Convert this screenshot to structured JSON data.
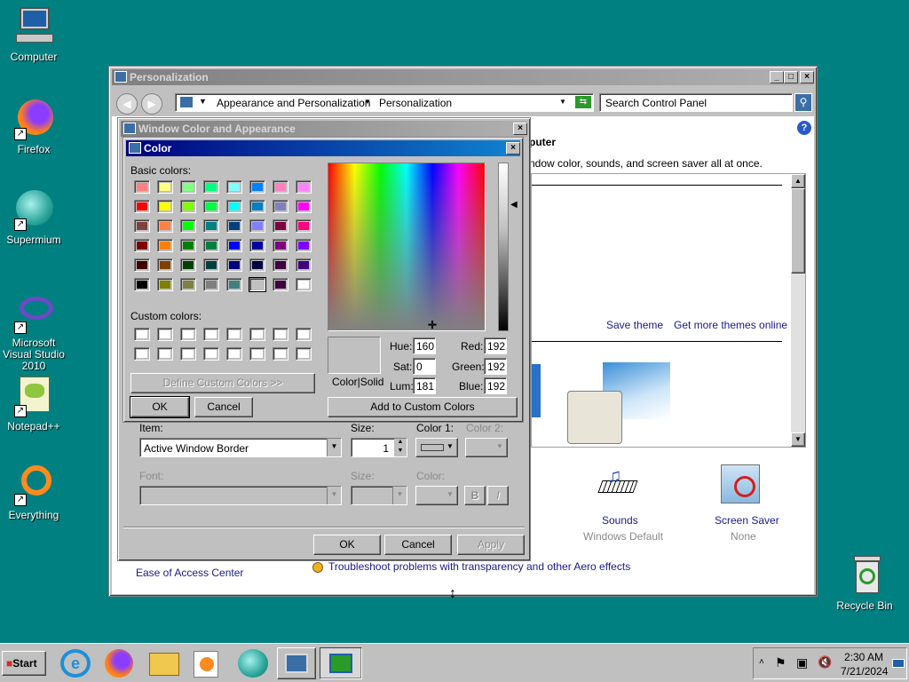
{
  "desktop": {
    "icons": [
      {
        "name": "computer-desktop-icon",
        "label": "Computer"
      },
      {
        "name": "firefox-desktop-icon",
        "label": "Firefox"
      },
      {
        "name": "supermium-desktop-icon",
        "label": "Supermium"
      },
      {
        "name": "visual-studio-desktop-icon",
        "label": "Microsoft Visual Studio 2010"
      },
      {
        "name": "notepadpp-desktop-icon",
        "label": "Notepad++"
      },
      {
        "name": "everything-desktop-icon",
        "label": "Everything"
      },
      {
        "name": "recycle-bin-desktop-icon",
        "label": "Recycle Bin"
      }
    ]
  },
  "personalization": {
    "title": "Personalization",
    "breadcrumb": [
      "Appearance and Personalization",
      "Personalization"
    ],
    "search_placeholder": "Search Control Panel",
    "heading_partial": "puter",
    "desc_partial": "ndow color, sounds, and screen saver all at once.",
    "save_theme": "Save theme",
    "get_more_themes": "Get more themes online",
    "sounds_label": "Sounds",
    "sounds_value": "Windows Default",
    "screensaver_label": "Screen Saver",
    "screensaver_value": "None",
    "ease_of_access": "Ease of Access Center",
    "troubleshoot": "Troubleshoot problems with transparency and other Aero effects"
  },
  "wca": {
    "title": "Window Color and Appearance",
    "item_label": "Item:",
    "item_value": "Active Window Border",
    "size_label": "Size:",
    "size_value": "1",
    "color1_label": "Color 1:",
    "color2_label": "Color 2:",
    "font_label": "Font:",
    "font_size_label": "Size:",
    "font_color_label": "Color:",
    "bold": "B",
    "italic": "I",
    "ok": "OK",
    "cancel": "Cancel",
    "apply": "Apply"
  },
  "color_dialog": {
    "title": "Color",
    "basic_colors_label": "Basic colors:",
    "custom_colors_label": "Custom colors:",
    "define_custom": "Define Custom Colors >>",
    "ok": "OK",
    "cancel": "Cancel",
    "add_custom": "Add to Custom Colors",
    "color_solid": "Color|Solid",
    "hue_label": "Hue:",
    "hue": "160",
    "sat_label": "Sat:",
    "sat": "0",
    "lum_label": "Lum:",
    "lum": "181",
    "red_label": "Red:",
    "red": "192",
    "green_label": "Green:",
    "green": "192",
    "blue_label": "Blue:",
    "blue": "192",
    "selected_color": "#c0c0c0",
    "basic_colors": [
      "#ff8080",
      "#ffff80",
      "#80ff80",
      "#00ff80",
      "#80ffff",
      "#0080ff",
      "#ff80c0",
      "#ff80ff",
      "#ff0000",
      "#ffff00",
      "#80ff00",
      "#00ff40",
      "#00ffff",
      "#0080c0",
      "#8080c0",
      "#ff00ff",
      "#804040",
      "#ff8040",
      "#00ff00",
      "#008080",
      "#004080",
      "#8080ff",
      "#800040",
      "#ff0080",
      "#800000",
      "#ff8000",
      "#008000",
      "#008040",
      "#0000ff",
      "#0000a0",
      "#800080",
      "#8000ff",
      "#400000",
      "#804000",
      "#004000",
      "#004040",
      "#000080",
      "#000040",
      "#400040",
      "#400080",
      "#000000",
      "#808000",
      "#808040",
      "#808080",
      "#408080",
      "#c0c0c0",
      "#400040",
      "#ffffff"
    ]
  },
  "taskbar": {
    "start": "Start",
    "time": "2:30 AM",
    "date": "7/21/2024",
    "apps": [
      "ie-taskbar-icon",
      "firefox-taskbar-icon",
      "explorer-taskbar-icon",
      "media-player-taskbar-icon",
      "supermium-taskbar-icon",
      "control-panel-taskbar-icon",
      "personalization-taskbar-icon"
    ]
  }
}
